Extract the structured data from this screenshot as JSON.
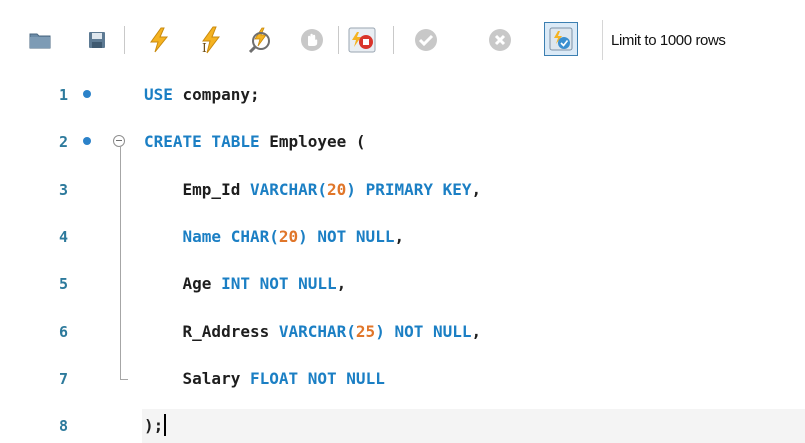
{
  "toolbar": {
    "items": [
      {
        "name": "open-folder-icon"
      },
      {
        "name": "save-icon"
      },
      {
        "name": "execute-icon"
      },
      {
        "name": "execute-current-icon"
      },
      {
        "name": "explain-icon"
      },
      {
        "name": "stop-icon"
      },
      {
        "name": "stop-on-error-icon"
      },
      {
        "name": "commit-icon"
      },
      {
        "name": "rollback-icon"
      },
      {
        "name": "autocommit-toggle-icon"
      }
    ],
    "limit_label": "Limit to 1000 rows"
  },
  "editor": {
    "lines": [
      {
        "number": "1",
        "breakpoint": true,
        "fold": "",
        "tokens": [
          {
            "t": "USE",
            "c": "kw"
          },
          {
            "t": " company;",
            "c": ""
          }
        ]
      },
      {
        "number": "2",
        "breakpoint": true,
        "fold": "open",
        "tokens": [
          {
            "t": "CREATE TABLE",
            "c": "kw"
          },
          {
            "t": " Employee (",
            "c": ""
          }
        ]
      },
      {
        "number": "3",
        "breakpoint": false,
        "fold": "body",
        "tokens": [
          {
            "t": "    Emp_Id ",
            "c": ""
          },
          {
            "t": "VARCHAR(",
            "c": "kw"
          },
          {
            "t": "20",
            "c": "num"
          },
          {
            "t": ") PRIMARY KEY",
            "c": "kw"
          },
          {
            "t": ",",
            "c": ""
          }
        ]
      },
      {
        "number": "4",
        "breakpoint": false,
        "fold": "body",
        "tokens": [
          {
            "t": "    ",
            "c": ""
          },
          {
            "t": "Name CHAR(",
            "c": "kw"
          },
          {
            "t": "20",
            "c": "num"
          },
          {
            "t": ") NOT NULL",
            "c": "kw"
          },
          {
            "t": ",",
            "c": ""
          }
        ]
      },
      {
        "number": "5",
        "breakpoint": false,
        "fold": "body",
        "tokens": [
          {
            "t": "    Age ",
            "c": ""
          },
          {
            "t": "INT NOT NULL",
            "c": "kw"
          },
          {
            "t": ",",
            "c": ""
          }
        ]
      },
      {
        "number": "6",
        "breakpoint": false,
        "fold": "body",
        "tokens": [
          {
            "t": "    R_Address ",
            "c": ""
          },
          {
            "t": "VARCHAR(",
            "c": "kw"
          },
          {
            "t": "25",
            "c": "num"
          },
          {
            "t": ") NOT NULL",
            "c": "kw"
          },
          {
            "t": ",",
            "c": ""
          }
        ]
      },
      {
        "number": "7",
        "breakpoint": false,
        "fold": "end",
        "tokens": [
          {
            "t": "    Salary ",
            "c": ""
          },
          {
            "t": "FLOAT NOT NULL",
            "c": "kw"
          }
        ]
      },
      {
        "number": "8",
        "breakpoint": false,
        "fold": "",
        "current": true,
        "tokens": [
          {
            "t": ");",
            "c": ""
          }
        ]
      }
    ]
  },
  "colors": {
    "keyword": "#1b7fc4",
    "number": "#e0762a",
    "line_number": "#2d7a9c",
    "breakpoint": "#2b82c9"
  }
}
